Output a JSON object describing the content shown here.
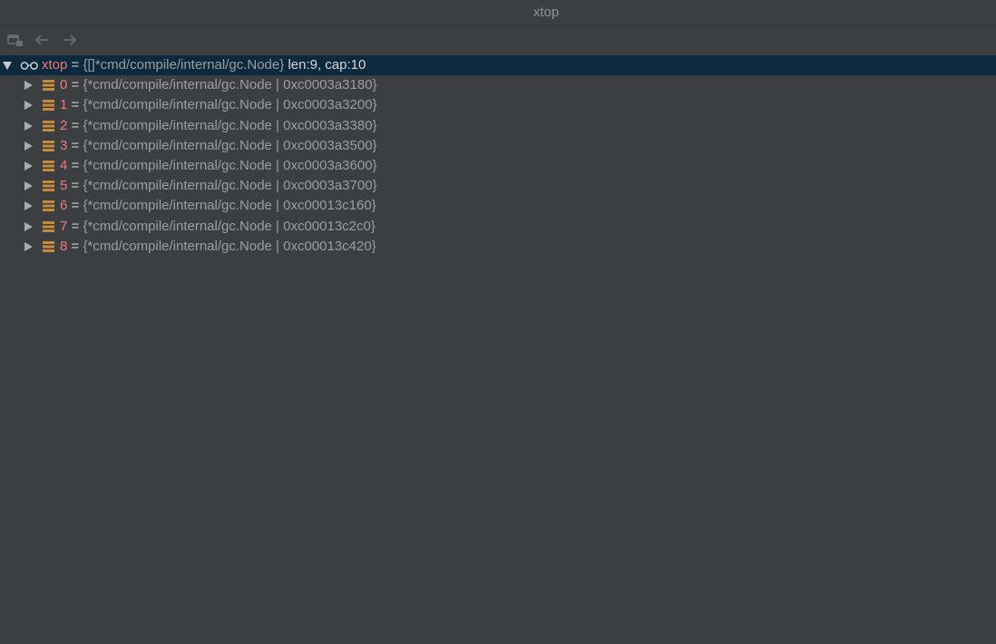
{
  "window": {
    "title": "xtop"
  },
  "toolbar": {
    "buttons": [
      {
        "name": "layout-icon"
      },
      {
        "name": "back-arrow-icon"
      },
      {
        "name": "forward-arrow-icon"
      }
    ]
  },
  "colors": {
    "background": "#3c3f41",
    "selection": "#0d293e",
    "variable_name": "#f0787a",
    "value_text": "#9b9ea1",
    "field_icon": "#c58a3a"
  },
  "root": {
    "name": "xtop",
    "eq": "=",
    "type": "{[]*cmd/compile/internal/gc.Node}",
    "extra": "len:9, cap:10",
    "icon": "watch-glasses-icon",
    "expanded": true
  },
  "children": [
    {
      "name": "0",
      "eq": "=",
      "value": "{*cmd/compile/internal/gc.Node | 0xc0003a3180}"
    },
    {
      "name": "1",
      "eq": "=",
      "value": "{*cmd/compile/internal/gc.Node | 0xc0003a3200}"
    },
    {
      "name": "2",
      "eq": "=",
      "value": "{*cmd/compile/internal/gc.Node | 0xc0003a3380}"
    },
    {
      "name": "3",
      "eq": "=",
      "value": "{*cmd/compile/internal/gc.Node | 0xc0003a3500}"
    },
    {
      "name": "4",
      "eq": "=",
      "value": "{*cmd/compile/internal/gc.Node | 0xc0003a3600}"
    },
    {
      "name": "5",
      "eq": "=",
      "value": "{*cmd/compile/internal/gc.Node | 0xc0003a3700}"
    },
    {
      "name": "6",
      "eq": "=",
      "value": "{*cmd/compile/internal/gc.Node | 0xc00013c160}"
    },
    {
      "name": "7",
      "eq": "=",
      "value": "{*cmd/compile/internal/gc.Node | 0xc00013c2c0}"
    },
    {
      "name": "8",
      "eq": "=",
      "value": "{*cmd/compile/internal/gc.Node | 0xc00013c420}"
    }
  ]
}
